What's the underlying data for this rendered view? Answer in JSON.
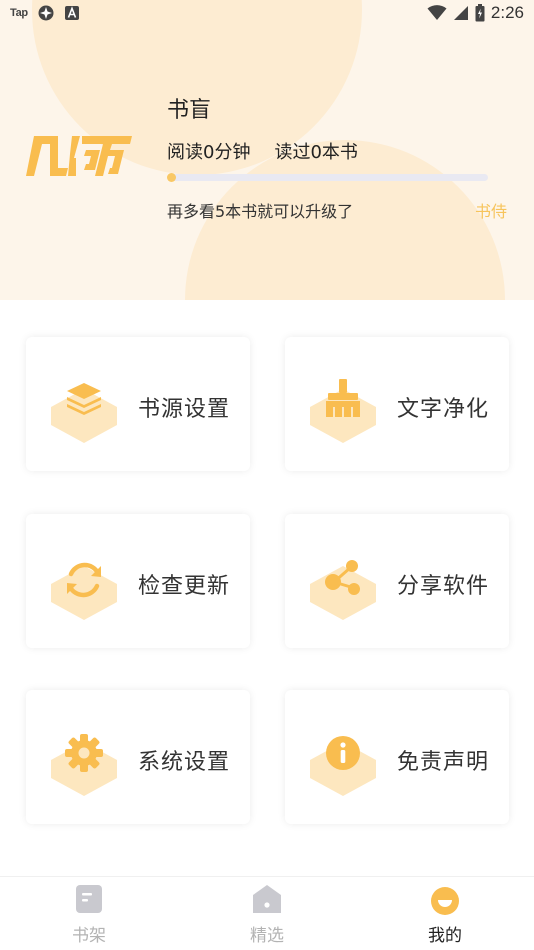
{
  "status_bar": {
    "app_badge": "Tap",
    "time": "2:26"
  },
  "profile": {
    "logo_text": "几何",
    "name": "书盲",
    "read_time": "阅读0分钟",
    "books_read": "读过0本书",
    "progress_fraction": 0.0,
    "upgrade_hint": "再多看5本书就可以升级了",
    "level": "书侍"
  },
  "menu": {
    "items": [
      {
        "label": "书源设置",
        "icon": "layers-icon"
      },
      {
        "label": "文字净化",
        "icon": "broom-icon"
      },
      {
        "label": "检查更新",
        "icon": "refresh-icon"
      },
      {
        "label": "分享软件",
        "icon": "share-icon"
      },
      {
        "label": "系统设置",
        "icon": "gear-icon"
      },
      {
        "label": "免责声明",
        "icon": "info-icon"
      }
    ]
  },
  "bottom_nav": {
    "items": [
      {
        "label": "书架",
        "icon": "bookshelf-icon",
        "active": false
      },
      {
        "label": "精选",
        "icon": "home-icon",
        "active": false
      },
      {
        "label": "我的",
        "icon": "profile-smile-icon",
        "active": true
      }
    ]
  },
  "colors": {
    "accent": "#f9c865",
    "header_bg": "#fdf5ea",
    "inactive_nav": "#b3b3b3"
  }
}
